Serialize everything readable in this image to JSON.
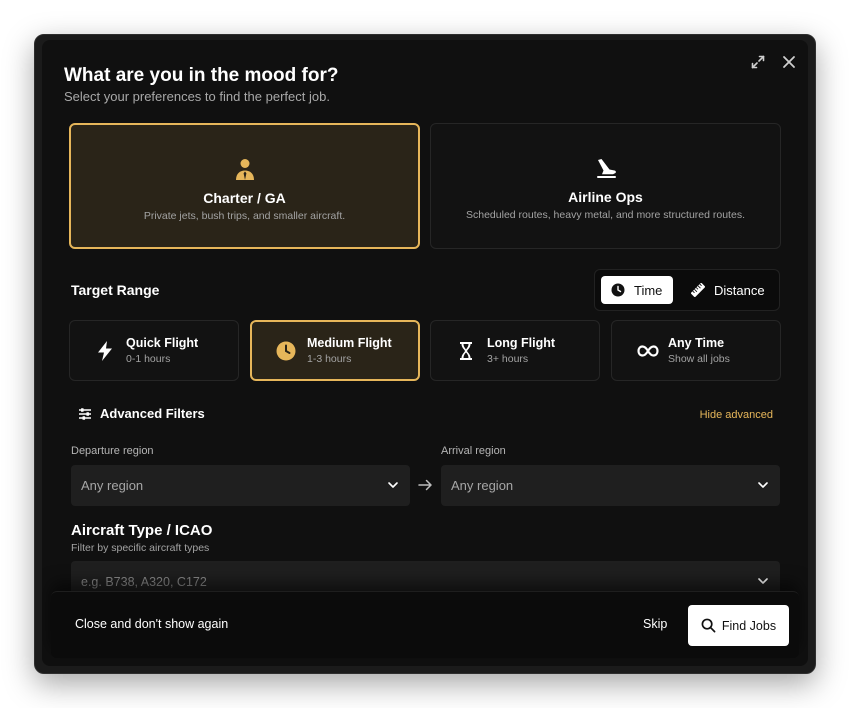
{
  "header": {
    "title": "What are you in the mood for?",
    "subtitle": "Select your preferences to find the perfect job."
  },
  "modes": [
    {
      "title": "Charter / GA",
      "description": "Private jets, bush trips, and smaller aircraft.",
      "icon": "pilot-icon",
      "selected": true
    },
    {
      "title": "Airline Ops",
      "description": "Scheduled routes, heavy metal, and more structured routes.",
      "icon": "airplane-icon",
      "selected": false
    }
  ],
  "target_range": {
    "title": "Target Range",
    "toggle": {
      "time_label": "Time",
      "distance_label": "Distance",
      "active": "Time"
    },
    "options": [
      {
        "title": "Quick Flight",
        "subtitle": "0-1 hours",
        "icon": "lightning-icon",
        "selected": false
      },
      {
        "title": "Medium Flight",
        "subtitle": "1-3 hours",
        "icon": "clock-icon",
        "selected": true
      },
      {
        "title": "Long Flight",
        "subtitle": "3+ hours",
        "icon": "hourglass-icon",
        "selected": false
      },
      {
        "title": "Any Time",
        "subtitle": "Show all jobs",
        "icon": "infinity-icon",
        "selected": false
      }
    ]
  },
  "advanced": {
    "title": "Advanced Filters",
    "hide_label": "Hide advanced",
    "departure_label": "Departure region",
    "departure_value": "Any region",
    "arrival_label": "Arrival region",
    "arrival_value": "Any region",
    "aircraft_title": "Aircraft Type / ICAO",
    "aircraft_subtitle": "Filter by specific aircraft types",
    "aircraft_placeholder": "e.g. B738, A320, C172"
  },
  "footer": {
    "close_label": "Close and don't show again",
    "skip_label": "Skip",
    "find_label": "Find Jobs"
  },
  "colors": {
    "accent": "#e6b65a",
    "background": "#101010",
    "selected_bg": "#2a2418"
  }
}
